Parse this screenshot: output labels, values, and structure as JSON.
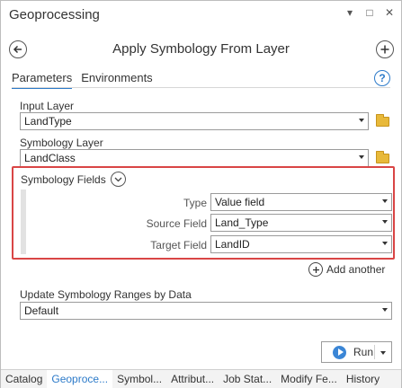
{
  "window": {
    "title": "Geoprocessing",
    "controls": [
      "▾",
      "□",
      "✕"
    ]
  },
  "tool": {
    "title": "Apply Symbology From Layer"
  },
  "tabs": {
    "parameters": "Parameters",
    "environments": "Environments"
  },
  "params": {
    "input_layer": {
      "label": "Input Layer",
      "value": "LandType"
    },
    "symbology_layer": {
      "label": "Symbology Layer",
      "value": "LandClass"
    },
    "symbology_fields": {
      "label": "Symbology Fields",
      "type": {
        "label": "Type",
        "value": "Value field"
      },
      "source": {
        "label": "Source Field",
        "value": "Land_Type"
      },
      "target": {
        "label": "Target Field",
        "value": "LandID"
      }
    },
    "add_another": "Add another",
    "update_ranges": {
      "label": "Update Symbology Ranges by Data",
      "value": "Default"
    }
  },
  "run": {
    "label": "Run"
  },
  "bottom_tabs": [
    "Catalog",
    "Geoproce...",
    "Symbol...",
    "Attribut...",
    "Job Stat...",
    "Modify Fe...",
    "History"
  ],
  "colors": {
    "highlight": "#d94545",
    "accent": "#2c7ac9",
    "folder": "#e8b93a"
  },
  "icons": {
    "back": "back-arrow-icon",
    "add": "add-icon",
    "help": "help-icon",
    "folder": "folder-icon",
    "collapse": "chevron-down-icon",
    "run": "play-icon"
  }
}
